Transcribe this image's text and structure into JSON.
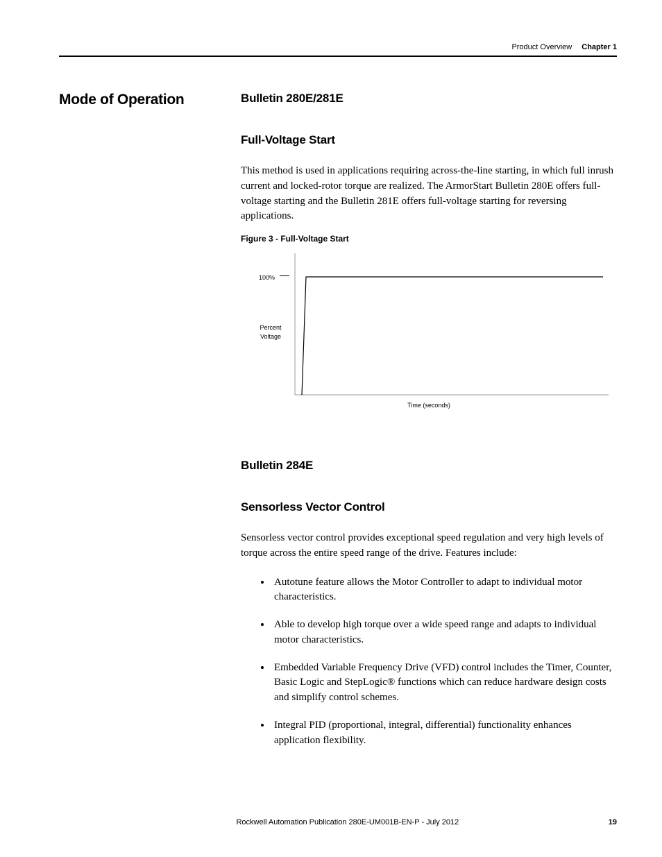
{
  "header": {
    "section": "Product Overview",
    "chapter": "Chapter 1"
  },
  "left": {
    "title": "Mode of Operation"
  },
  "s1": {
    "heading": "Bulletin 280E/281E",
    "sub": "Full-Voltage Start",
    "para": "This method is used in applications requiring across-the-line starting, in which full inrush current and locked-rotor torque are realized. The ArmorStart Bulletin 280E offers full-voltage starting and the Bulletin 281E offers full-voltage starting for reversing applications.",
    "fig_caption": "Figure 3 - Full-Voltage Start"
  },
  "chart": {
    "y100": "100%",
    "ylabel1": "Percent",
    "ylabel2": "Voltage",
    "xlabel": "Time (seconds)"
  },
  "s2": {
    "heading": "Bulletin 284E",
    "sub": "Sensorless Vector Control",
    "para": "Sensorless vector control provides exceptional speed regulation and very high levels of torque across the entire speed range of the drive. Features include:",
    "bullets": [
      "Autotune feature allows the Motor Controller to adapt to individual motor characteristics.",
      "Able to develop high torque over a wide speed range and adapts to individual motor characteristics.",
      "Embedded Variable Frequency Drive (VFD) control includes the Timer, Counter, Basic Logic and StepLogic® functions which can reduce hardware design costs and simplify control schemes.",
      "Integral PID (proportional, integral, differential) functionality enhances application flexibility."
    ]
  },
  "footer": {
    "publication": "Rockwell Automation Publication 280E-UM001B-EN-P - July 2012",
    "page": "19"
  },
  "chart_data": {
    "type": "line",
    "title": "Full-Voltage Start",
    "xlabel": "Time (seconds)",
    "ylabel": "Percent Voltage",
    "ylim": [
      0,
      100
    ],
    "series": [
      {
        "name": "Percent Voltage",
        "x": [
          0,
          0.05,
          1.0
        ],
        "y": [
          0,
          100,
          100
        ]
      }
    ],
    "note": "Step response: voltage rises immediately from 0 to 100% and remains at 100%."
  }
}
